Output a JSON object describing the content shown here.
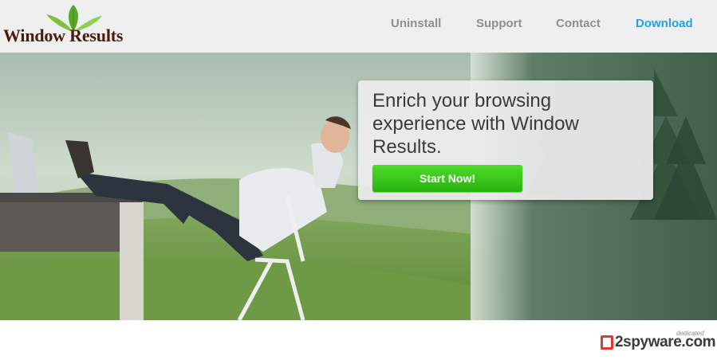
{
  "brand": {
    "name": "Window Results",
    "logo_icon": "green-leaves-icon"
  },
  "nav": [
    {
      "label": "Uninstall"
    },
    {
      "label": "Support"
    },
    {
      "label": "Contact"
    },
    {
      "label": "Download"
    }
  ],
  "hero": {
    "headline": "Enrich your browsing experience with Window Results.",
    "cta_label": "Start Now!"
  },
  "watermark": {
    "text": "2spyware.com",
    "tag": "dedicated",
    "icon": "2-badge-icon"
  },
  "colors": {
    "header_bg": "#efefef",
    "nav_text": "#8f8f8f",
    "nav_active": "#22a2e6",
    "cta_green": "#37c51c",
    "brand_text": "#4a1a10"
  }
}
